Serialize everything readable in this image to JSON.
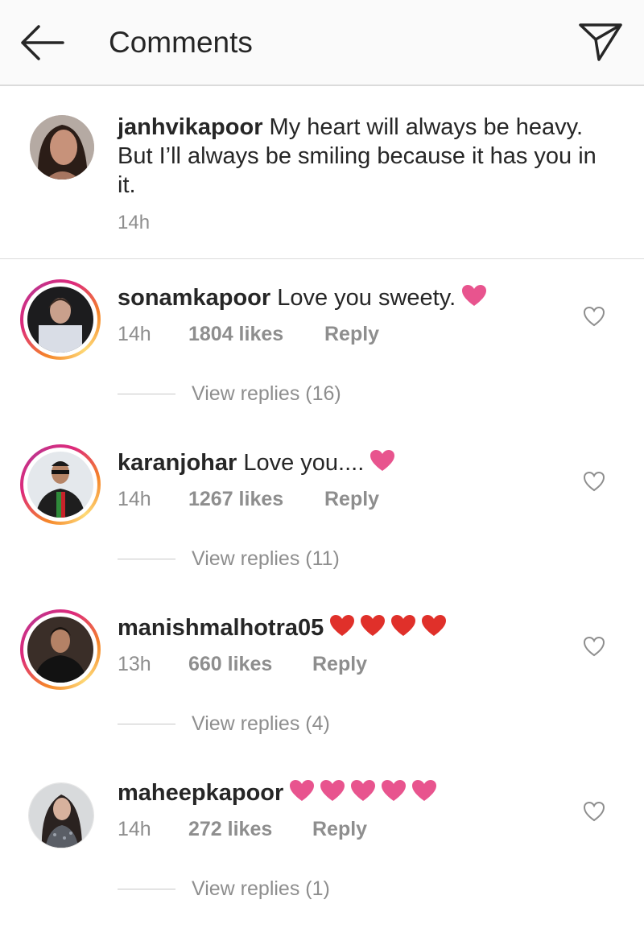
{
  "header": {
    "title": "Comments"
  },
  "caption": {
    "username": "janhvikapoor",
    "text": " My heart will always be heavy. But I’ll always be smiling because it has you in it.",
    "time": "14h"
  },
  "comments": [
    {
      "username": "sonamkapoor",
      "text": " Love you sweety.",
      "time": "14h",
      "likes": "1804 likes",
      "reply_label": "Reply",
      "view_replies": "View replies (16)",
      "hearts": 1,
      "heart_color": "#e8548e"
    },
    {
      "username": "karanjohar",
      "text": " Love you....",
      "time": "14h",
      "likes": "1267 likes",
      "reply_label": "Reply",
      "view_replies": "View replies (11)",
      "hearts": 1,
      "heart_color": "#e8548e"
    },
    {
      "username": "manishmalhotra05",
      "text": "",
      "time": "13h",
      "likes": "660 likes",
      "reply_label": "Reply",
      "view_replies": "View replies (4)",
      "hearts": 4,
      "heart_color": "#e0302a"
    },
    {
      "username": "maheepkapoor",
      "text": "",
      "time": "14h",
      "likes": "272 likes",
      "reply_label": "Reply",
      "view_replies": "View replies (1)",
      "hearts": 5,
      "heart_color": "#e8548e"
    }
  ],
  "icons": {
    "back": "back-arrow-icon",
    "share": "direct-send-icon",
    "like": "heart-outline-icon",
    "emoji": "heart-emoji-icon"
  }
}
